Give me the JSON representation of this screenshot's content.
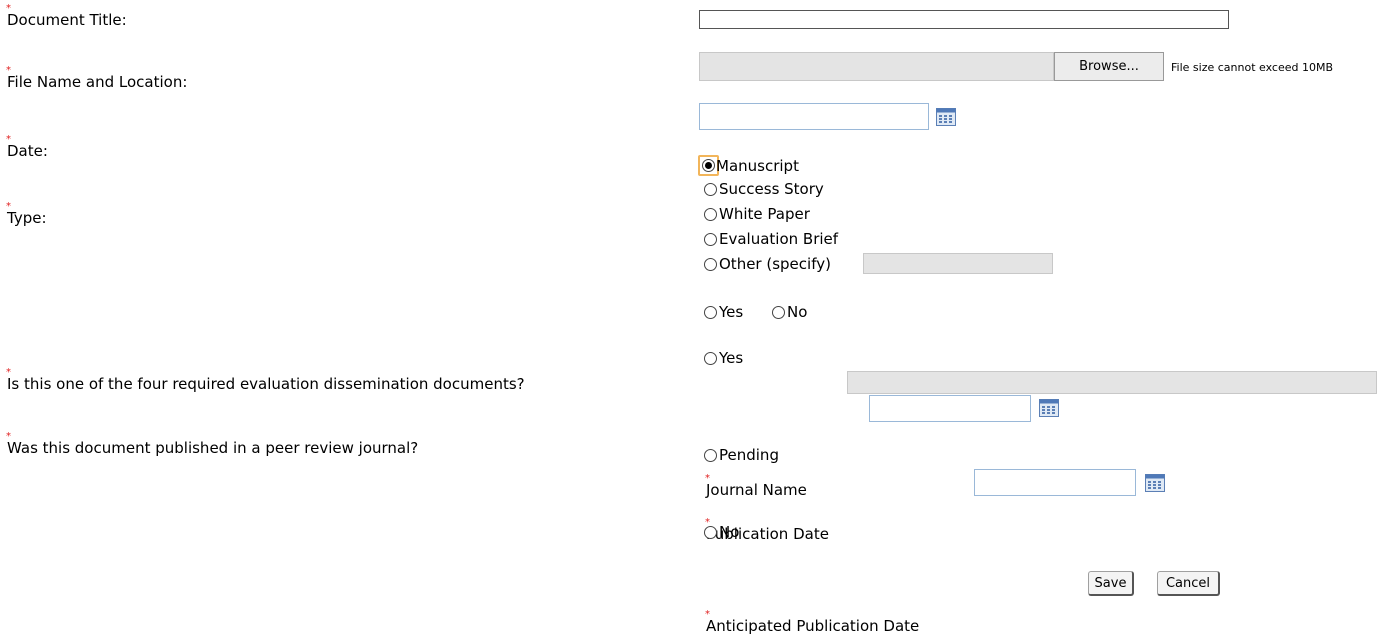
{
  "form": {
    "document_title_label": "Document Title:",
    "document_title_value": "",
    "file_label": "File Name and Location:",
    "file_value": "",
    "browse_label": "Browse...",
    "file_note": "File size cannot exceed 10MB",
    "date_label": "Date:",
    "date_value": "",
    "type_label": "Type:",
    "type_options": [
      {
        "label": "Manuscript",
        "selected": true
      },
      {
        "label": "Success Story",
        "selected": false
      },
      {
        "label": "White Paper",
        "selected": false
      },
      {
        "label": "Evaluation Brief",
        "selected": false
      },
      {
        "label": "Other (specify)",
        "selected": false
      }
    ],
    "other_value": "",
    "required_q_label": "Is this one of the four required evaluation dissemination documents?",
    "required_yes": "Yes",
    "required_no": "No",
    "peer_q_label": "Was this document published in a peer review journal?",
    "peer_yes": "Yes",
    "journal_name_label": "Journal Name",
    "journal_name_value": "",
    "publication_date_label": "Publication Date",
    "publication_date_value": "",
    "peer_pending": "Pending",
    "anticipated_label": "Anticipated Publication Date",
    "anticipated_value": "",
    "peer_no": "No"
  },
  "buttons": {
    "save": "Save",
    "cancel": "Cancel"
  },
  "colors": {
    "required_mark": "#e02020",
    "focus_ring": "#f2b55a",
    "input_border": "#9ab8d8",
    "disabled_bg": "#e4e4e4"
  }
}
